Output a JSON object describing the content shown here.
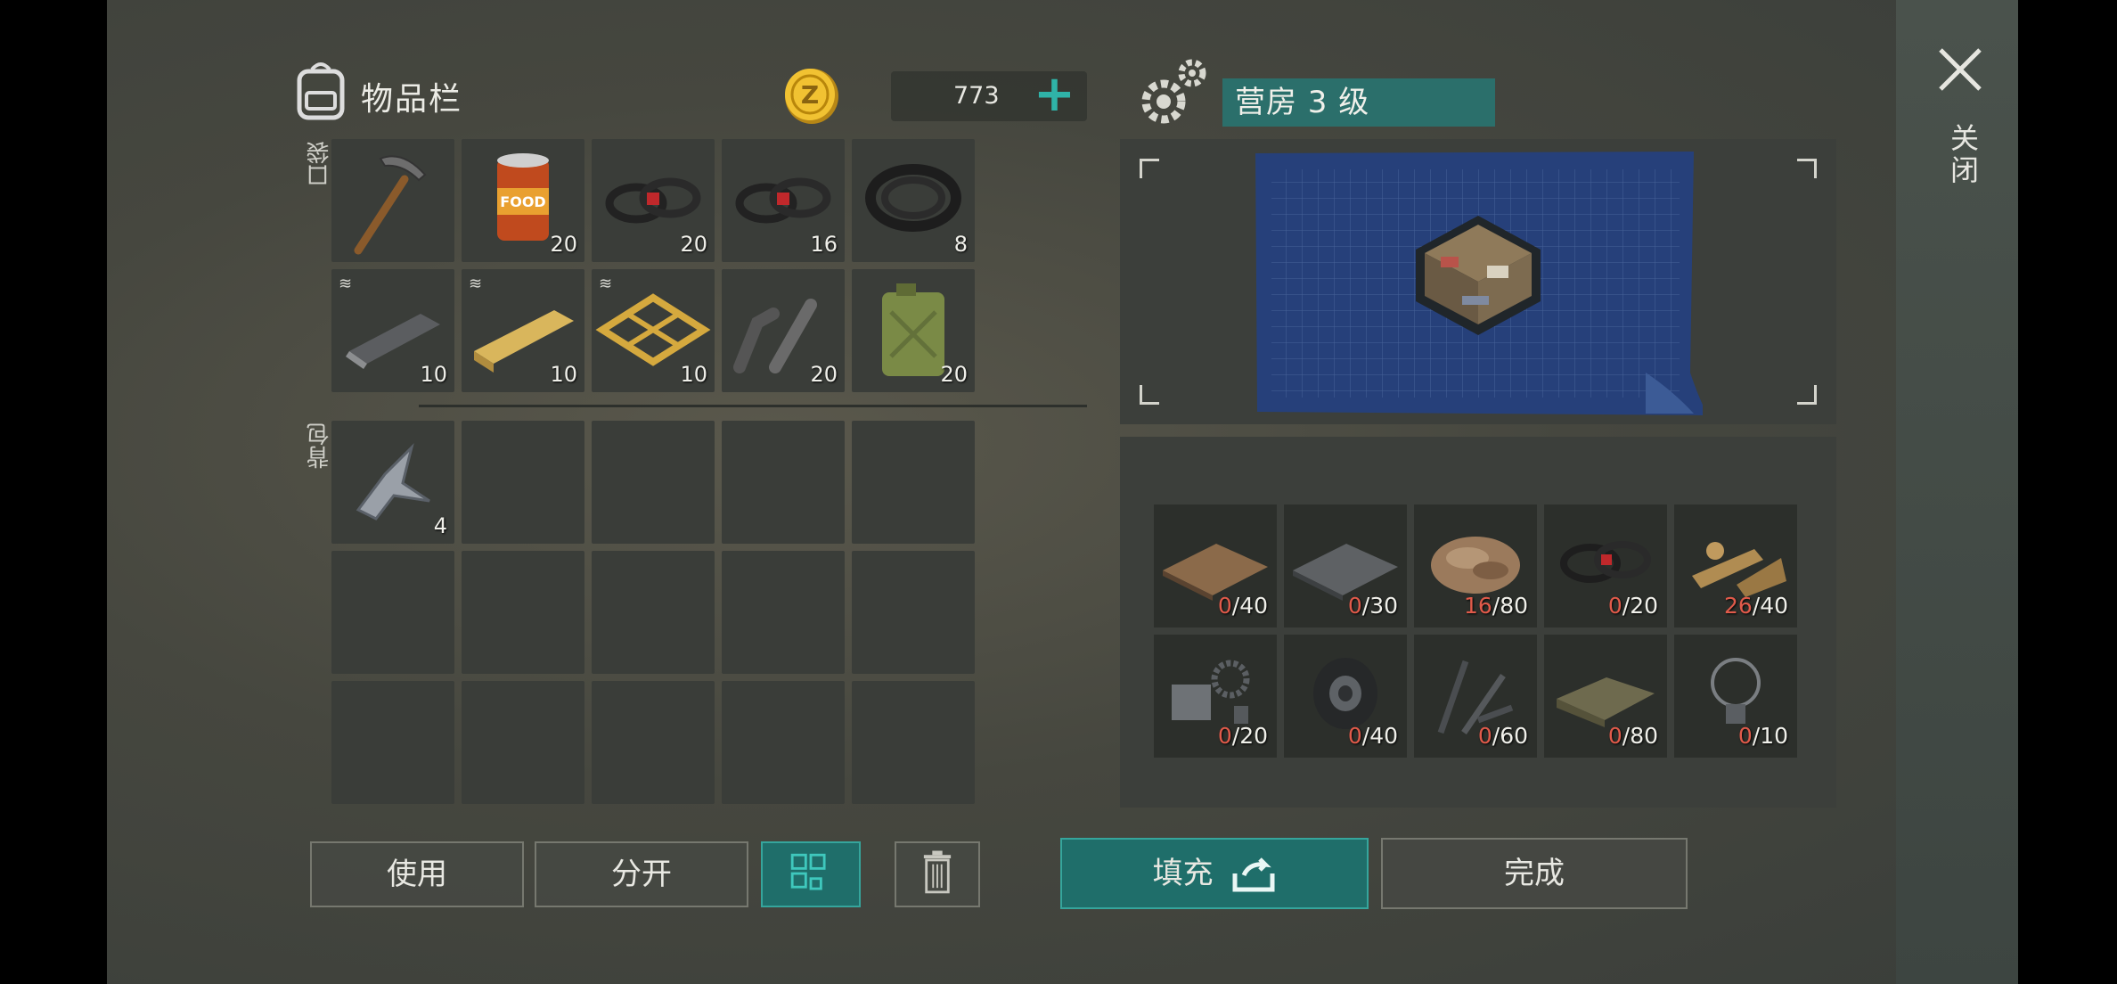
{
  "inventory": {
    "title": "物品栏",
    "coins": "773",
    "coin_symbol": "Z",
    "add_coins_label": "+",
    "pocket_label": "口袋",
    "backpack_label": "背包",
    "pocket_items": [
      {
        "name": "pickaxe",
        "qty": ""
      },
      {
        "name": "canned-food",
        "qty": "20"
      },
      {
        "name": "wire-bundle",
        "qty": "20"
      },
      {
        "name": "wire-bundle",
        "qty": "16"
      },
      {
        "name": "rubber-hose",
        "qty": "8"
      },
      {
        "name": "metal-bar-blueprint",
        "qty": "10"
      },
      {
        "name": "wood-plank-blueprint",
        "qty": "10"
      },
      {
        "name": "wood-frame-blueprint",
        "qty": "10"
      },
      {
        "name": "metal-pipes",
        "qty": "20"
      },
      {
        "name": "jerrycan",
        "qty": "20"
      }
    ],
    "backpack_items": [
      {
        "name": "scrap-metal",
        "qty": "4"
      }
    ],
    "use_label": "使用",
    "split_label": "分开"
  },
  "build": {
    "title": "营房 3 级",
    "fill_label": "填充",
    "done_label": "完成",
    "materials": [
      {
        "name": "wood-board",
        "have": "0",
        "need": "/40"
      },
      {
        "name": "metal-sheet",
        "have": "0",
        "need": "/30"
      },
      {
        "name": "wood-chips",
        "have": "16",
        "need": "/80"
      },
      {
        "name": "wire",
        "have": "0",
        "need": "/20"
      },
      {
        "name": "wood-scraps",
        "have": "26",
        "need": "/40"
      },
      {
        "name": "hinges-parts",
        "have": "0",
        "need": "/20"
      },
      {
        "name": "tire",
        "have": "0",
        "need": "/40"
      },
      {
        "name": "screws",
        "have": "0",
        "need": "/60"
      },
      {
        "name": "cloth",
        "have": "0",
        "need": "/80"
      },
      {
        "name": "light-bulb",
        "have": "0",
        "need": "/10"
      }
    ]
  },
  "close_label": "关闭",
  "colors": {
    "accent": "#2fb3a8",
    "missing": "#e05a4a",
    "title_bar": "#2b6f6b"
  }
}
